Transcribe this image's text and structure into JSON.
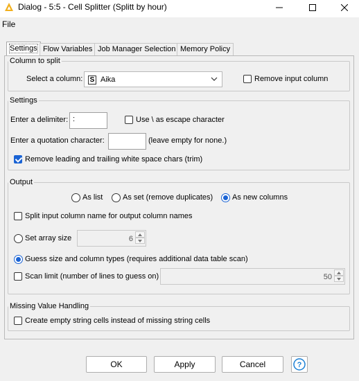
{
  "window": {
    "title": "Dialog - 5:5 - Cell Splitter (Splitt by hour)"
  },
  "menu": {
    "file": "File"
  },
  "tabs": [
    {
      "label": "Settings",
      "active": true
    },
    {
      "label": "Flow Variables",
      "active": false
    },
    {
      "label": "Job Manager Selection",
      "active": false
    },
    {
      "label": "Memory Policy",
      "active": false
    }
  ],
  "column_to_split": {
    "legend": "Column to split",
    "select_label": "Select a column:",
    "column_type_badge": "S",
    "selected_column": "Aika",
    "remove_input_label": "Remove input column",
    "remove_input_checked": false
  },
  "settings": {
    "legend": "Settings",
    "delimiter_label": "Enter a delimiter:",
    "delimiter_value": ":",
    "escape_label": "Use \\ as escape character",
    "escape_checked": false,
    "quote_label": "Enter a quotation character:",
    "quote_value": "",
    "quote_hint": "(leave empty for none.)",
    "trim_label": "Remove leading and trailing white space chars (trim)",
    "trim_checked": true
  },
  "output": {
    "legend": "Output",
    "as_list_label": "As list",
    "as_set_label": "As set (remove duplicates)",
    "as_new_columns_label": "As new columns",
    "selected_mode": "As new columns",
    "split_names_label": "Split input column name for output column names",
    "split_names_checked": false,
    "set_array_size_label": "Set array size",
    "array_size_value": "6",
    "guess_label": "Guess size and column types (requires additional data table scan)",
    "size_mode": "guess",
    "scan_limit_label": "Scan limit (number of lines to guess on)",
    "scan_limit_checked": false,
    "scan_limit_value": "50"
  },
  "missing": {
    "legend": "Missing Value Handling",
    "empty_string_label": "Create empty string cells instead of missing string cells",
    "empty_string_checked": false
  },
  "buttons": {
    "ok": "OK",
    "apply": "Apply",
    "cancel": "Cancel",
    "help": "?"
  },
  "colors": {
    "accent": "#1a63d4",
    "title_icon": "#f2b01e"
  }
}
